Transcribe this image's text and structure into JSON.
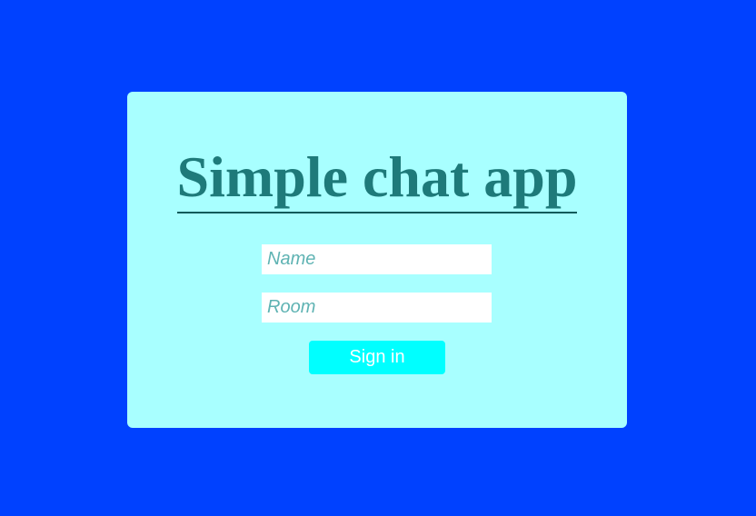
{
  "app": {
    "title": "Simple chat app"
  },
  "form": {
    "name_placeholder": "Name",
    "name_value": "",
    "room_placeholder": "Room",
    "room_value": "",
    "submit_label": "Sign in"
  },
  "colors": {
    "page_background": "#0041ff",
    "card_background": "#a8ffff",
    "title_text": "#1e7a7a",
    "button_background": "#00ffff",
    "button_text": "#ffffff"
  }
}
